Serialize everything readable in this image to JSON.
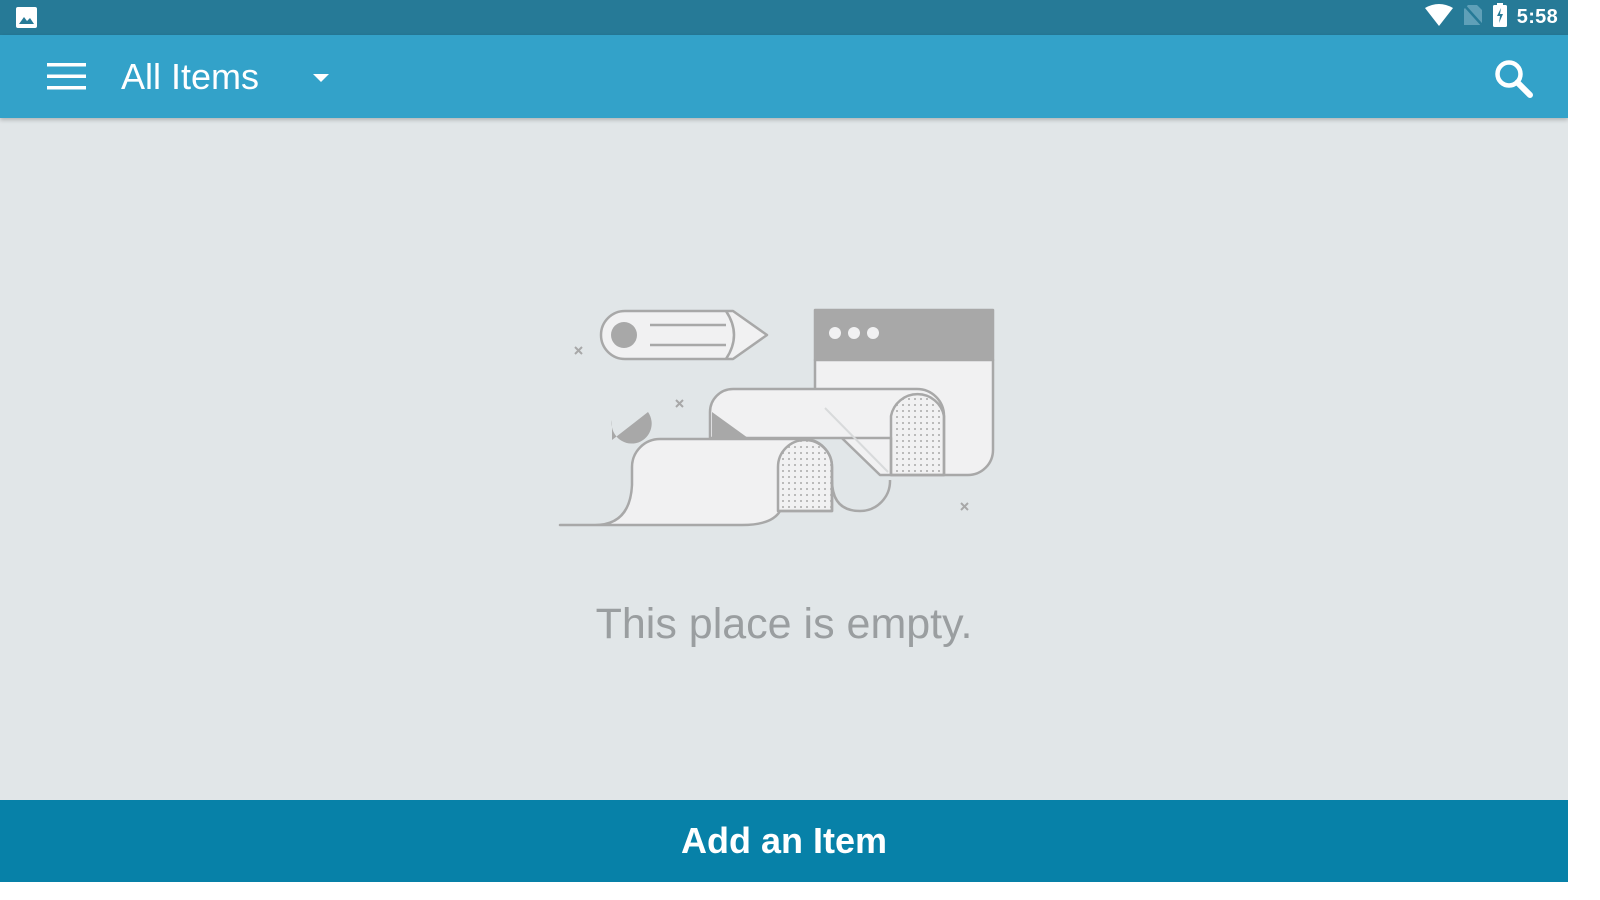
{
  "status_bar": {
    "time": "5:58",
    "icons": [
      "image-notification-icon",
      "wifi-icon",
      "no-sim-icon",
      "battery-charging-icon"
    ]
  },
  "app_bar": {
    "title": "All Items",
    "menu_icon": "hamburger-menu-icon",
    "dropdown_icon": "dropdown-arrow-icon",
    "search_icon": "search-icon",
    "background_color": "#33a2c9"
  },
  "empty_state": {
    "illustration": "empty-scrolls-illustration",
    "message": "This place is empty."
  },
  "footer": {
    "add_button_label": "Add an Item",
    "background_color": "#0781a8"
  }
}
